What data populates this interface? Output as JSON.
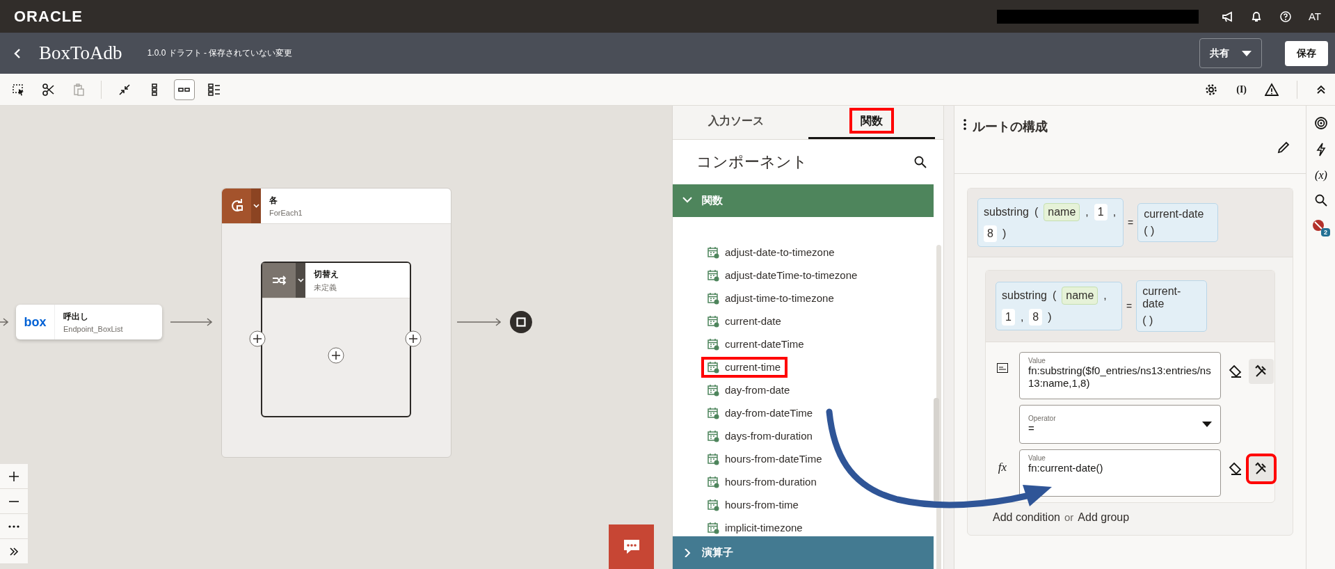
{
  "header": {
    "logo": "ORACLE",
    "user": "AT",
    "title": "BoxToAdb",
    "subtitle": "1.0.0 ドラフト - 保存されていない変更",
    "buttons": [
      {
        "label": "共有",
        "kind": "dropdown"
      },
      {
        "label": "保存",
        "kind": "primary"
      }
    ]
  },
  "toolbar": {
    "tools": [
      {
        "kind": "select",
        "selected": false,
        "disabled": false
      },
      {
        "kind": "cut",
        "selected": false,
        "disabled": false
      },
      {
        "kind": "paste",
        "selected": false,
        "disabled": true
      },
      {
        "kind": "collapse",
        "selected": false,
        "disabled": false
      },
      {
        "kind": "vertical",
        "selected": false,
        "disabled": false
      },
      {
        "kind": "horizontal",
        "selected": true,
        "disabled": false
      },
      {
        "kind": "details",
        "selected": false,
        "disabled": false
      }
    ],
    "variables_label": "(I)"
  },
  "canvas": {
    "invoke": {
      "label": "呼出し",
      "name": "Endpoint_BoxList",
      "logo": "box"
    },
    "foreach": {
      "label": "各",
      "name": "ForEach1"
    },
    "switch": {
      "label": "切替え",
      "name": "未定義"
    }
  },
  "functions_panel": {
    "tabs": [
      {
        "label": "入力ソース",
        "selected": false,
        "highlighted": false
      },
      {
        "label": "関数",
        "selected": true,
        "highlighted": true
      }
    ],
    "heading": "コンポーネント",
    "groups": [
      {
        "label": "関数",
        "expanded": true,
        "color": "#4e855c",
        "items": [
          {
            "label": "adjust-date-to-timezone",
            "highlighted": false
          },
          {
            "label": "adjust-dateTime-to-timezone",
            "highlighted": false
          },
          {
            "label": "adjust-time-to-timezone",
            "highlighted": false
          },
          {
            "label": "current-date",
            "highlighted": false
          },
          {
            "label": "current-dateTime",
            "highlighted": false
          },
          {
            "label": "current-time",
            "highlighted": true
          },
          {
            "label": "day-from-date",
            "highlighted": false
          },
          {
            "label": "day-from-dateTime",
            "highlighted": false
          },
          {
            "label": "days-from-duration",
            "highlighted": false
          },
          {
            "label": "hours-from-dateTime",
            "highlighted": false
          },
          {
            "label": "hours-from-duration",
            "highlighted": false
          },
          {
            "label": "hours-from-time",
            "highlighted": false
          },
          {
            "label": "implicit-timezone",
            "highlighted": false
          }
        ]
      },
      {
        "label": "演算子",
        "expanded": false,
        "color": "#437a91"
      }
    ]
  },
  "route_panel": {
    "title": "ルートの構成",
    "summaries": [
      {
        "left": [
          {
            "text": "substring",
            "kind": "plain"
          },
          {
            "text": "(",
            "kind": "plain"
          },
          {
            "text": "name",
            "kind": "field"
          },
          {
            "text": ",",
            "kind": "plain"
          },
          {
            "text": "1",
            "kind": "literal"
          },
          {
            "text": ",",
            "kind": "plain"
          },
          {
            "text": "8",
            "kind": "literal"
          },
          {
            "text": ")",
            "kind": "plain"
          }
        ],
        "operator": "=",
        "right": [
          {
            "text": "current-date",
            "kind": "plain"
          },
          {
            "text": "( )",
            "kind": "plain"
          }
        ]
      },
      {
        "left": [
          {
            "text": "substring",
            "kind": "plain"
          },
          {
            "text": "(",
            "kind": "plain"
          },
          {
            "text": "name",
            "kind": "field"
          },
          {
            "text": ",",
            "kind": "plain"
          },
          {
            "text": "1",
            "kind": "literal"
          },
          {
            "text": ",",
            "kind": "plain"
          },
          {
            "text": "8",
            "kind": "literal"
          },
          {
            "text": ")",
            "kind": "plain"
          }
        ],
        "operator": "=",
        "right": [
          {
            "text": "current-date",
            "kind": "plain"
          },
          {
            "text": "( )",
            "kind": "plain"
          }
        ]
      }
    ],
    "editor_rows": [
      {
        "kind": "text",
        "label": "Value",
        "value": "fn:substring($f0_entries/ns13:entries/ns13:name,1,8)",
        "highlighted": false
      },
      {
        "kind": "select",
        "label": "Operator",
        "value": "="
      },
      {
        "kind": "expression",
        "prefix": "fx",
        "label": "Value",
        "value": "fn:current-date()",
        "highlighted": true
      }
    ],
    "add_condition": "Add condition",
    "or": "or",
    "add_group": "Add group"
  },
  "side_strip": {
    "variables_label": "(x)",
    "error_count": "2"
  }
}
